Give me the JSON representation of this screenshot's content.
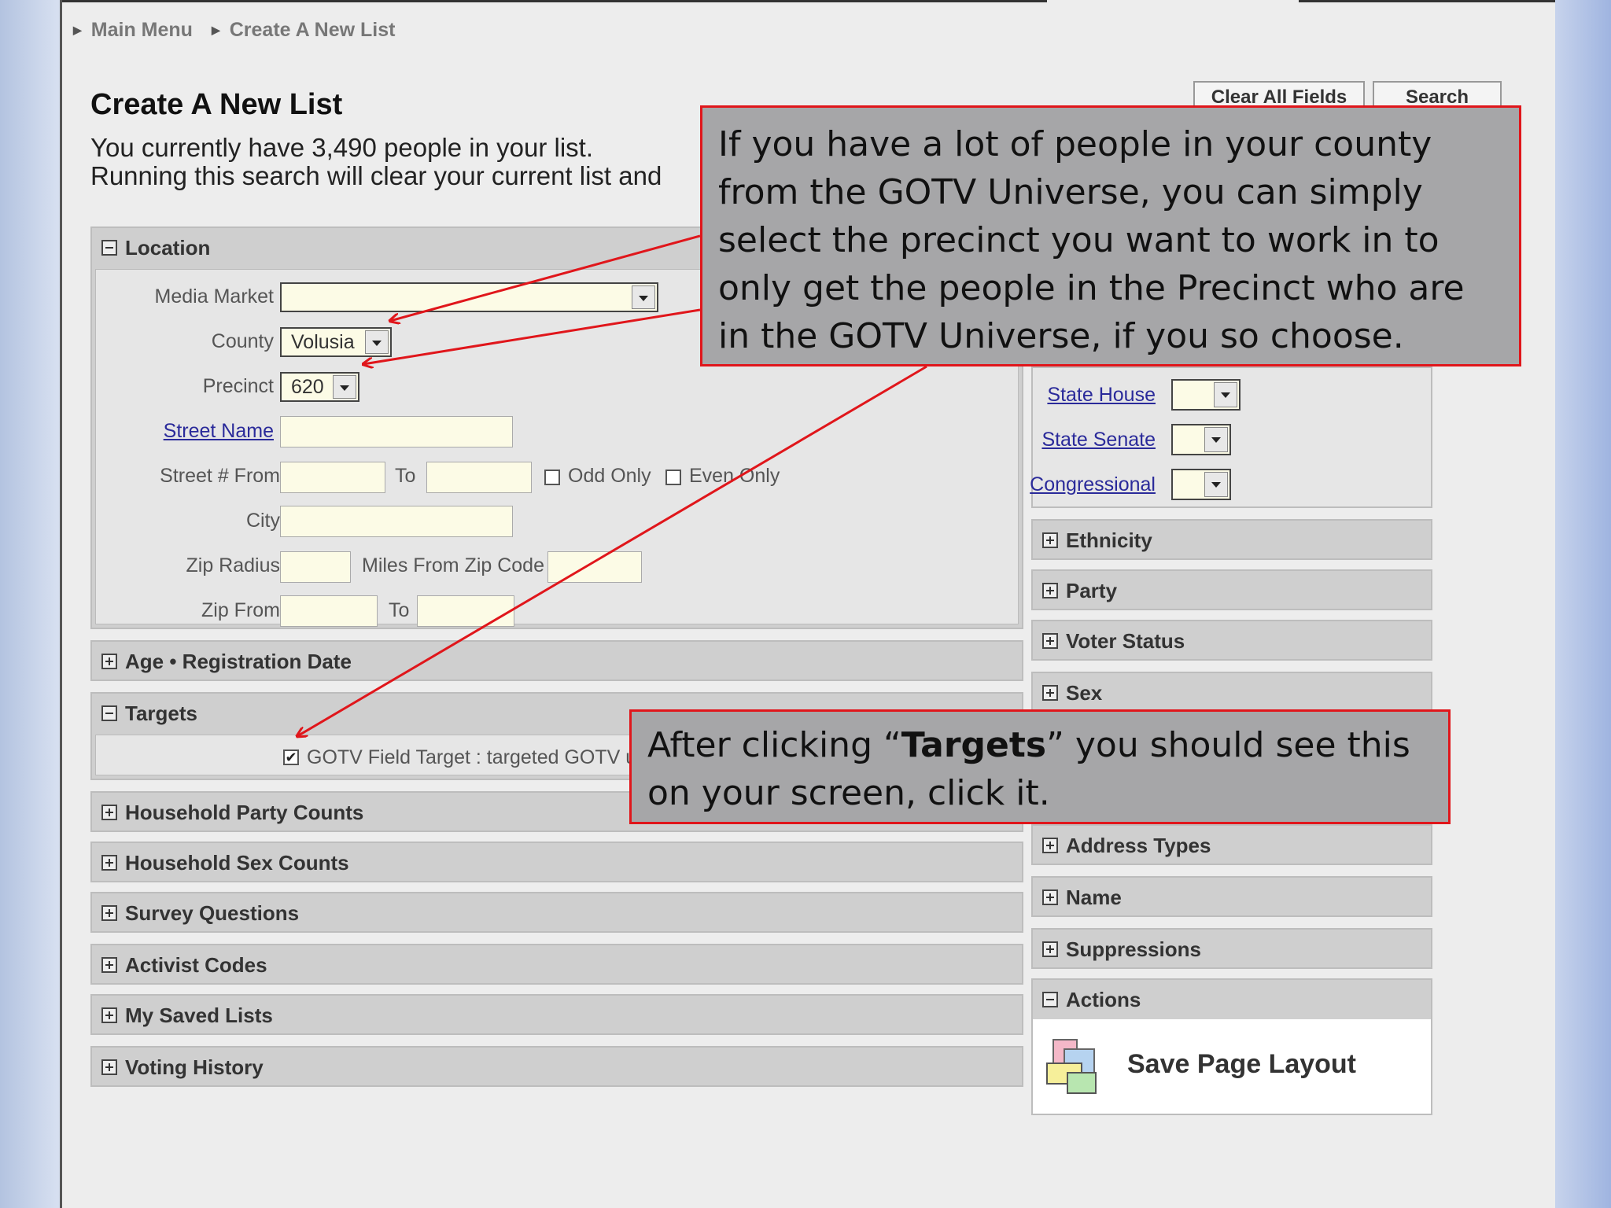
{
  "breadcrumb": {
    "items": [
      "Main Menu",
      "Create A New List"
    ]
  },
  "page": {
    "title": "Create A New List",
    "subtitle_line1": "You currently have 3,490 people in your list.",
    "subtitle_line2": "Running this search will clear your current list and"
  },
  "toolbar": {
    "clear_label": "Clear All Fields",
    "search_label": "Search"
  },
  "location": {
    "header": "Location",
    "media_market_label": "Media Market",
    "county_label": "County",
    "county_value": "Volusia",
    "precinct_label": "Precinct",
    "precinct_value": "620",
    "street_name_label": "Street Name",
    "street_from_label": "Street # From",
    "to_label": "To",
    "odd_only_label": "Odd Only",
    "even_only_label": "Even Only",
    "city_label": "City",
    "zip_radius_label": "Zip Radius",
    "miles_label": "Miles From Zip Code",
    "zip_from_label": "Zip From"
  },
  "left_sections": {
    "age": "Age • Registration Date",
    "targets": "Targets",
    "household_party": "Household Party Counts",
    "household_sex": "Household Sex Counts",
    "survey": "Survey Questions",
    "activist": "Activist Codes",
    "saved_lists": "My Saved Lists",
    "voting_history": "Voting History"
  },
  "targets": {
    "gotv_label": "GOTV Field Target : targeted GOTV u",
    "gotv_checked": true
  },
  "districts": {
    "state_house": "State House",
    "state_senate": "State Senate",
    "congressional": "Congressional"
  },
  "right_sections": {
    "ethnicity": "Ethnicity",
    "party": "Party",
    "voter_status": "Voter Status",
    "sex": "Sex",
    "address_types": "Address Types",
    "name": "Name",
    "suppressions": "Suppressions",
    "actions": "Actions"
  },
  "actions": {
    "save_layout": "Save Page Layout"
  },
  "callouts": {
    "top": "If you have a lot of people in your county from the GOTV Universe, you can simply select the precinct you want to work in to only get the people in the Precinct who are in the GOTV Universe, if you so choose.",
    "bottom_before": "After clicking “",
    "bottom_bold": "Targets",
    "bottom_after": "” you should see this on your screen, click it."
  },
  "colors": {
    "callout_border": "#e0161b",
    "callout_fill": "#a6a6a8",
    "link": "#2a2a9a"
  },
  "icons": {
    "expand": "plus-box-icon",
    "collapse": "minus-box-icon",
    "save": "layout-stack-icon"
  }
}
